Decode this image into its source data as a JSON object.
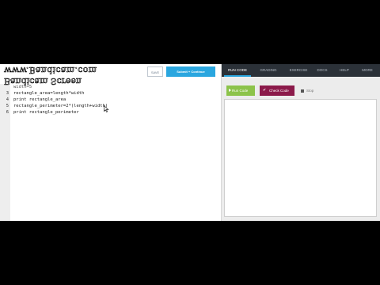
{
  "watermark": {
    "line1": "www.Bandicam.com",
    "line2": "Bandicam Screen"
  },
  "editor": {
    "save_label": "SAVE",
    "submit_label": "Submit + Continue",
    "partial_line": "width=5",
    "lines": [
      {
        "num": "3",
        "code": "rectangle_area=length*width"
      },
      {
        "num": "4",
        "code": "print rectangle_area"
      },
      {
        "num": "5",
        "code": "rectangle_perimeter=2*(length+width)"
      },
      {
        "num": "6",
        "code": "print rectangle_perimeter"
      }
    ]
  },
  "panel": {
    "tabs": [
      "RUN CODE",
      "GRADING",
      "EXERCISE",
      "DOCS",
      "HELP",
      "MORE"
    ],
    "active_tab": "RUN CODE",
    "run_label": "Run Code",
    "check_label": "Check Code",
    "stop_label": "Stop"
  },
  "colors": {
    "submit": "#2aa6df",
    "run": "#8cc34a",
    "check": "#8b1a4a",
    "nav": "#2b3138"
  }
}
